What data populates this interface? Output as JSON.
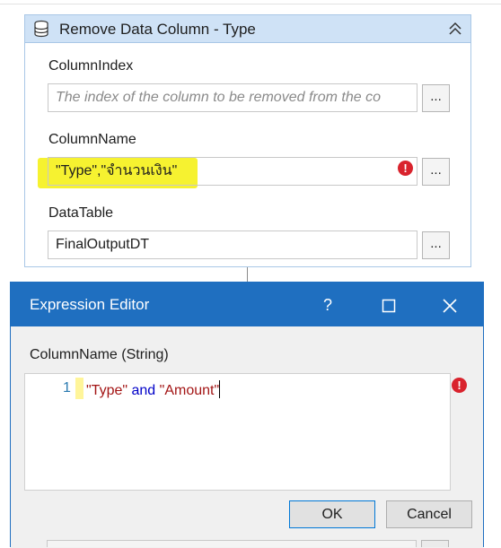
{
  "activity": {
    "title": "Remove Data Column - Type",
    "icon": "data-table-icon",
    "fields": [
      {
        "label": "ColumnIndex",
        "value": "",
        "placeholder": "The index of the column to be removed from the co"
      },
      {
        "label": "ColumnName",
        "value": "\"Type\",\"จำนวนเงิน\"",
        "error": true
      },
      {
        "label": "DataTable",
        "value": "FinalOutputDT"
      }
    ],
    "ellipsis_label": "...",
    "error_glyph": "!"
  },
  "dialog": {
    "title": "Expression Editor",
    "help": "?",
    "maximize": "☐",
    "close": "✕",
    "property_label": "ColumnName (String)",
    "line_number": "1",
    "code_tokens": [
      {
        "text": "\"Type\"",
        "kind": "str"
      },
      {
        "text": " and ",
        "kind": "kw"
      },
      {
        "text": "\"Amount\"",
        "kind": "str"
      }
    ],
    "ok_label": "OK",
    "cancel_label": "Cancel"
  },
  "colors": {
    "title_bar": "#1f6fc0",
    "activity_header": "#cfe2f6",
    "highlight": "#f6f230",
    "error": "#d9232d"
  }
}
